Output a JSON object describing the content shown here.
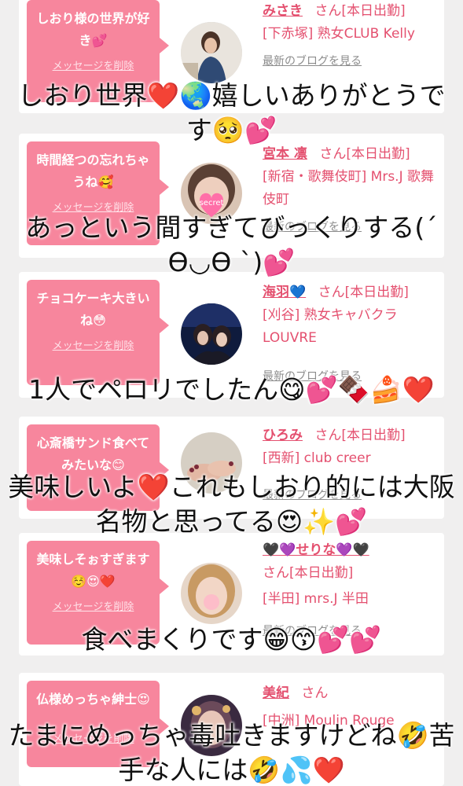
{
  "status_suffix": "さん[本日出勤]",
  "delete_label": "メッセージを削除",
  "blog_label": "最新のブログを見る",
  "entries": [
    {
      "message": "しおり様の世界が好き💕",
      "name": "みさき",
      "suffix": "さん[本日出勤]",
      "shop": "[下赤塚] 熟女CLUB Kelly",
      "caption": "しおり世界❤️🌏嬉しいありがとうです🥺💕"
    },
    {
      "message": "時間経つの忘れちゃうね🥰",
      "name": "宮本 凛",
      "suffix": "さん[本日出勤]",
      "shop": "[新宿・歌舞伎町] Mrs.J 歌舞伎町",
      "avatar_text": "secret",
      "caption": "あっという間すぎてびっくりする(ˊ ϴ◡ϴ ˋ)💕"
    },
    {
      "message": "チョコケーキ大きいね😳",
      "name": "海羽💙",
      "suffix": "さん[本日出勤]",
      "shop": "[刈谷] 熟女キャバクラ LOUVRE",
      "caption": "1人でペロリでしたん😋💕🍫🍰❤️"
    },
    {
      "message": "心斎橋サンド食べてみたいな😊",
      "name": "ひろみ",
      "suffix": "さん[本日出勤]",
      "shop": "[西新] club creer",
      "caption": "美味しいよ❤️これもしおり的には大阪名物と思ってる😍✨💕"
    },
    {
      "message": "美味しそぉすぎます☺️😍❤️",
      "name": "🖤💜せりな💜🖤",
      "suffix": "さん[本日出勤]",
      "shop": "[半田] mrs.J 半田",
      "caption": "食べまくりです😁😙💕💕"
    },
    {
      "message": "仏様めっちゃ紳士😍",
      "name": "美紀",
      "suffix": "さん",
      "shop": "[中洲] Moulin Rouge",
      "caption": "たまにめっちゃ毒吐きますけどね🤣苦手な人には🤣💦❤️"
    }
  ]
}
